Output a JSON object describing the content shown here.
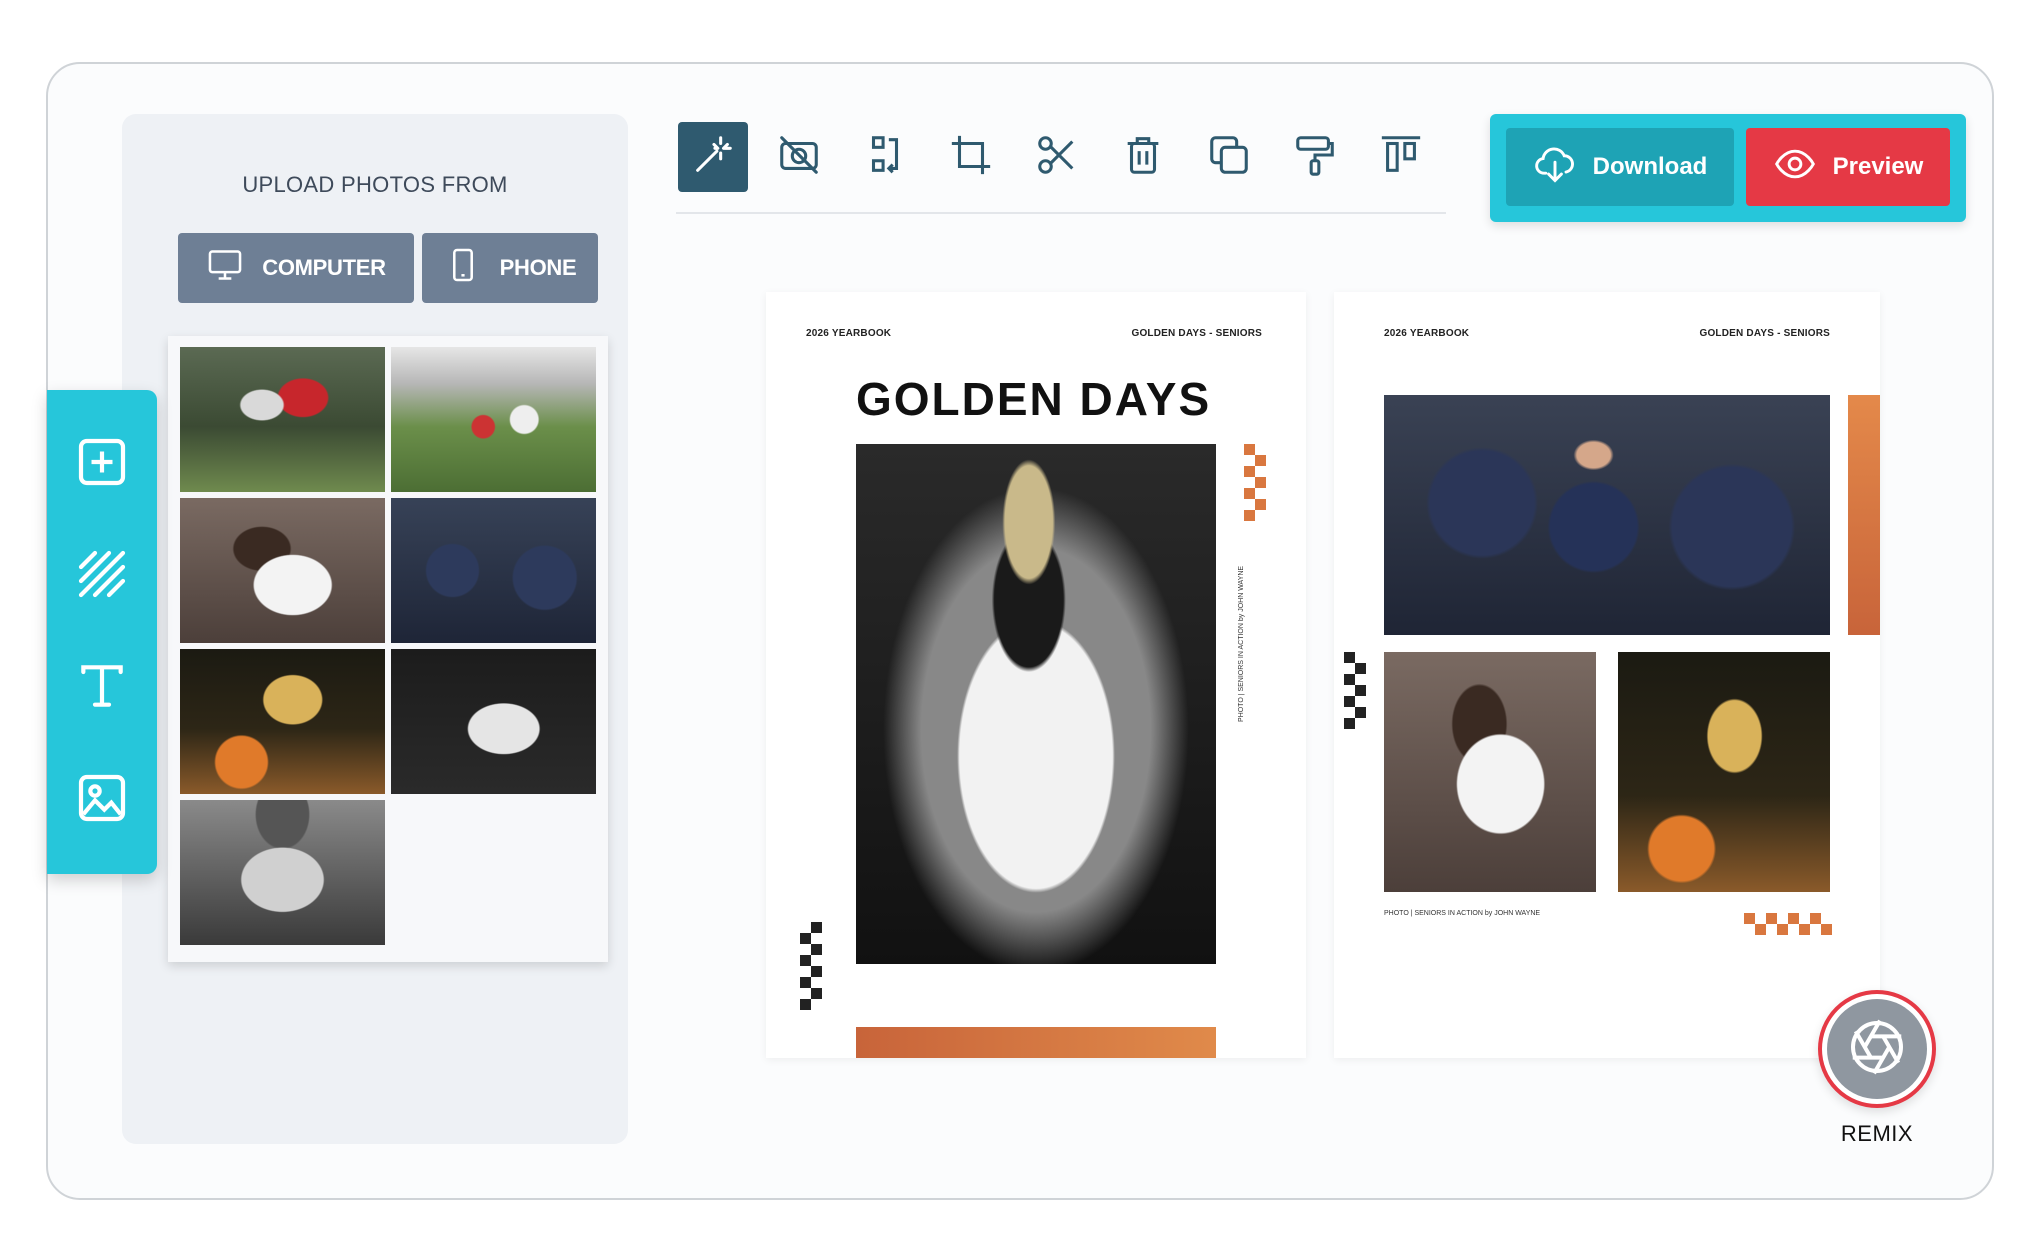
{
  "upload_panel": {
    "title": "UPLOAD PHOTOS FROM",
    "computer_label": "COMPUTER",
    "phone_label": "PHONE",
    "photos": [
      "photo-team-huddle",
      "photo-football-field",
      "photo-hug",
      "photo-players-29",
      "photo-basketball-girl",
      "photo-running-back",
      "photo-player-23"
    ]
  },
  "side_rail": {
    "items": [
      "add-icon",
      "pattern-icon",
      "text-icon",
      "image-icon"
    ]
  },
  "toolbar": {
    "tools": [
      "magic-wand-icon",
      "no-photo-icon",
      "swap-icon",
      "crop-icon",
      "cut-icon",
      "trash-icon",
      "duplicate-icon",
      "format-paint-icon",
      "align-top-icon"
    ],
    "active_tool": "magic-wand-icon"
  },
  "actions": {
    "download_label": "Download",
    "preview_label": "Preview"
  },
  "spread": {
    "left_page": {
      "header_left": "2026 YEARBOOK",
      "header_right": "GOLDEN DAYS - SENIORS",
      "headline": "GOLDEN DAYS",
      "photo_credit": "PHOTO | SENIORS IN ACTION by JOHN WAYNE"
    },
    "right_page": {
      "header_left": "2026 YEARBOOK",
      "header_right": "GOLDEN DAYS - SENIORS",
      "photo_credit": "PHOTO | SENIORS IN ACTION by JOHN WAYNE"
    }
  },
  "remix": {
    "label": "REMIX"
  },
  "colors": {
    "accent_cyan": "#26c6da",
    "download_bg": "#1ea3b5",
    "preview_bg": "#e53945",
    "source_button_bg": "#6e7f95",
    "active_tool_bg": "#2f5a6f",
    "orange_accent": "#c8643a"
  }
}
